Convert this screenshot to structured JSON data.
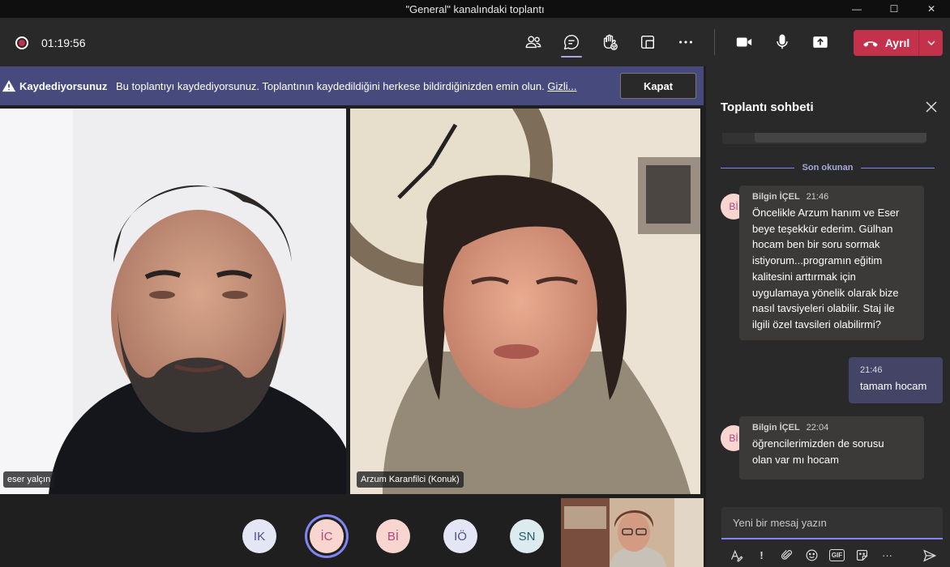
{
  "window": {
    "title": "\"General\" kanalındaki toplantı",
    "minimize": "—",
    "maximize": "☐",
    "close": "✕"
  },
  "toolbar": {
    "timer": "01:19:56",
    "leave_label": "Ayrıl"
  },
  "banner": {
    "title": "Kaydediyorsunuz",
    "text": "Bu toplantıyı kaydediyorsunuz. Toplantının kaydedildiğini herkese bildirdiğinizden emin olun. ",
    "link": "Gizli...",
    "close_label": "Kapat"
  },
  "videos": [
    {
      "name": "eser yalçın"
    },
    {
      "name": "Arzum Karanfilci (Konuk)"
    }
  ],
  "participants": [
    {
      "initials": "IK",
      "bg": "#e5e6f5",
      "fg": "#4b4f8a"
    },
    {
      "initials": "İC",
      "bg": "#f9d5cf",
      "fg": "#b24782",
      "active": true
    },
    {
      "initials": "Bİ",
      "bg": "#f9d5cf",
      "fg": "#b24782"
    },
    {
      "initials": "IÖ",
      "bg": "#e5e6f5",
      "fg": "#4b4f8a"
    },
    {
      "initials": "SN",
      "bg": "#dcebee",
      "fg": "#255f6b"
    }
  ],
  "chat": {
    "title": "Toplantı sohbeti",
    "last_read": "Son okunan",
    "messages": [
      {
        "author": "Bilgin İÇEL",
        "avatar": "Bİ",
        "time": "21:46",
        "lines": [
          "Öncelikle Arzum hanım ve Eser",
          "beye teşekkür ederim. Gülhan",
          "hocam ben bir soru sormak",
          "istiyorum...programın eğitim",
          "kalitesini arttırmak için",
          "uygulamaya yönelik olarak bize",
          "nasıl tavsiyeleri olabilir. Staj ile",
          "ilgili özel tavsileri olabilirmi?"
        ]
      },
      {
        "own": true,
        "time": "21:46",
        "text": "tamam hocam"
      },
      {
        "author": "Bilgin İÇEL",
        "avatar": "Bİ",
        "time": "22:04",
        "lines": [
          "öğrencilerimizden de sorusu",
          "olan var mı hocam"
        ]
      }
    ],
    "composer_placeholder": "Yeni bir mesaj yazın",
    "tools": [
      "format-icon",
      "important-icon",
      "attach-icon",
      "emoji-icon",
      "gif-icon",
      "sticker-icon",
      "more-icon"
    ],
    "gif_label": "GIF",
    "more_label": "···",
    "important_label": "!"
  },
  "colors": {
    "accent": "#7f85f5",
    "leave": "#c4314b",
    "banner": "#474a7d",
    "panel": "#292929"
  }
}
